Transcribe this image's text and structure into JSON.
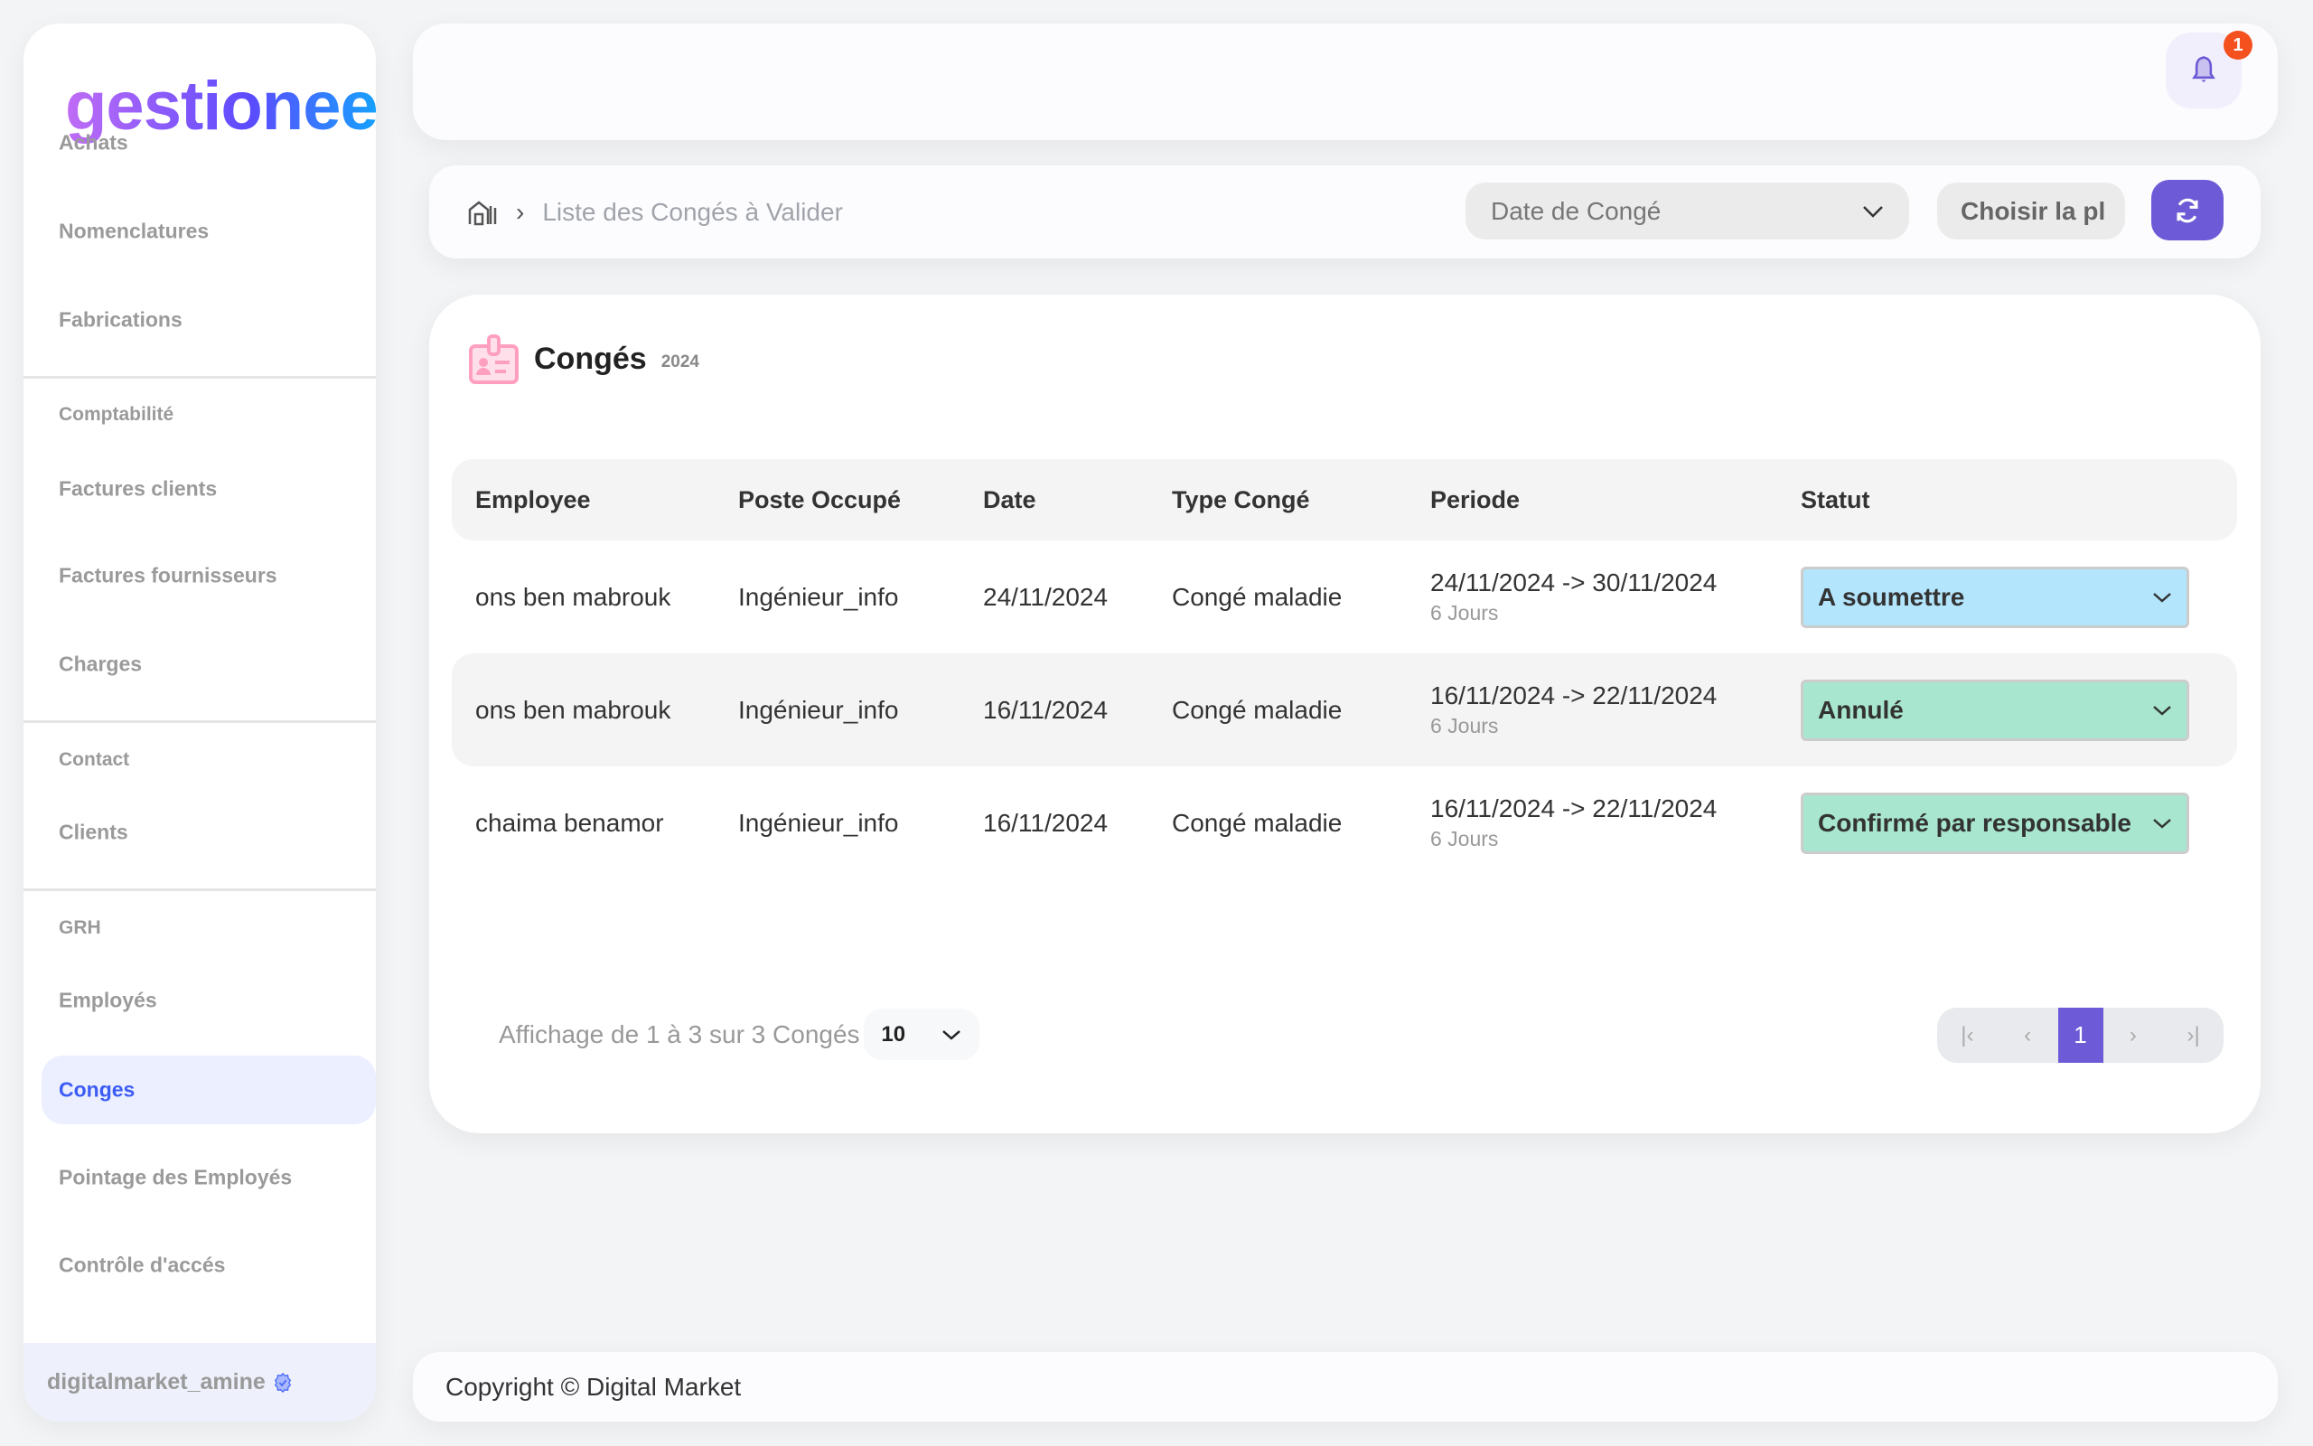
{
  "sidebar": {
    "logo": "gestioneer",
    "items": [
      {
        "label": "Achats",
        "type": "item"
      },
      {
        "label": "Nomenclatures",
        "type": "item"
      },
      {
        "label": "Fabrications",
        "type": "item"
      },
      {
        "label": "Comptabilité",
        "type": "section"
      },
      {
        "label": "Factures clients",
        "type": "item"
      },
      {
        "label": "Factures fournisseurs",
        "type": "item"
      },
      {
        "label": "Charges",
        "type": "item"
      },
      {
        "label": "Contact",
        "type": "section"
      },
      {
        "label": "Clients",
        "type": "item"
      },
      {
        "label": "GRH",
        "type": "section"
      },
      {
        "label": "Employés",
        "type": "item"
      },
      {
        "label": "Conges",
        "type": "item",
        "active": true
      },
      {
        "label": "Pointage des Employés",
        "type": "item"
      },
      {
        "label": "Contrôle d'accés",
        "type": "item"
      }
    ],
    "user": "digitalmarket_amine"
  },
  "header": {
    "notification_count": "1"
  },
  "toolbar": {
    "breadcrumb": "Liste des Congés à Valider",
    "date_select": "Date de Congé",
    "choisir": "Choisir la pl"
  },
  "main": {
    "title": "Congés",
    "year": "2024",
    "columns": [
      "Employee",
      "Poste Occupé",
      "Date",
      "Type Congé",
      "Periode",
      "Statut"
    ],
    "rows": [
      {
        "employee": "ons ben mabrouk",
        "poste": "Ingénieur_info",
        "date": "24/11/2024",
        "type": "Congé maladie",
        "periode": "24/11/2024 -> 30/11/2024",
        "jours": "6 Jours",
        "statut": "A soumettre",
        "color": "#b3e5fc"
      },
      {
        "employee": "ons ben mabrouk",
        "poste": "Ingénieur_info",
        "date": "16/11/2024",
        "type": "Congé maladie",
        "periode": "16/11/2024 -> 22/11/2024",
        "jours": "6 Jours",
        "statut": "Annulé",
        "color": "#a8e6cf"
      },
      {
        "employee": "chaima benamor",
        "poste": "Ingénieur_info",
        "date": "16/11/2024",
        "type": "Congé maladie",
        "periode": "16/11/2024 -> 22/11/2024",
        "jours": "6 Jours",
        "statut": "Confirmé par responsable",
        "color": "#a8e6cf"
      }
    ],
    "pagination": {
      "info": "Affichage de 1 à 3 sur 3 Congés",
      "page_size": "10",
      "current_page": "1"
    }
  },
  "footer": {
    "copyright": "Copyright © Digital Market"
  },
  "colors": {
    "accent": "#6c5ad6",
    "active_nav": "#3d5cf5",
    "badge": "#f4511e"
  }
}
